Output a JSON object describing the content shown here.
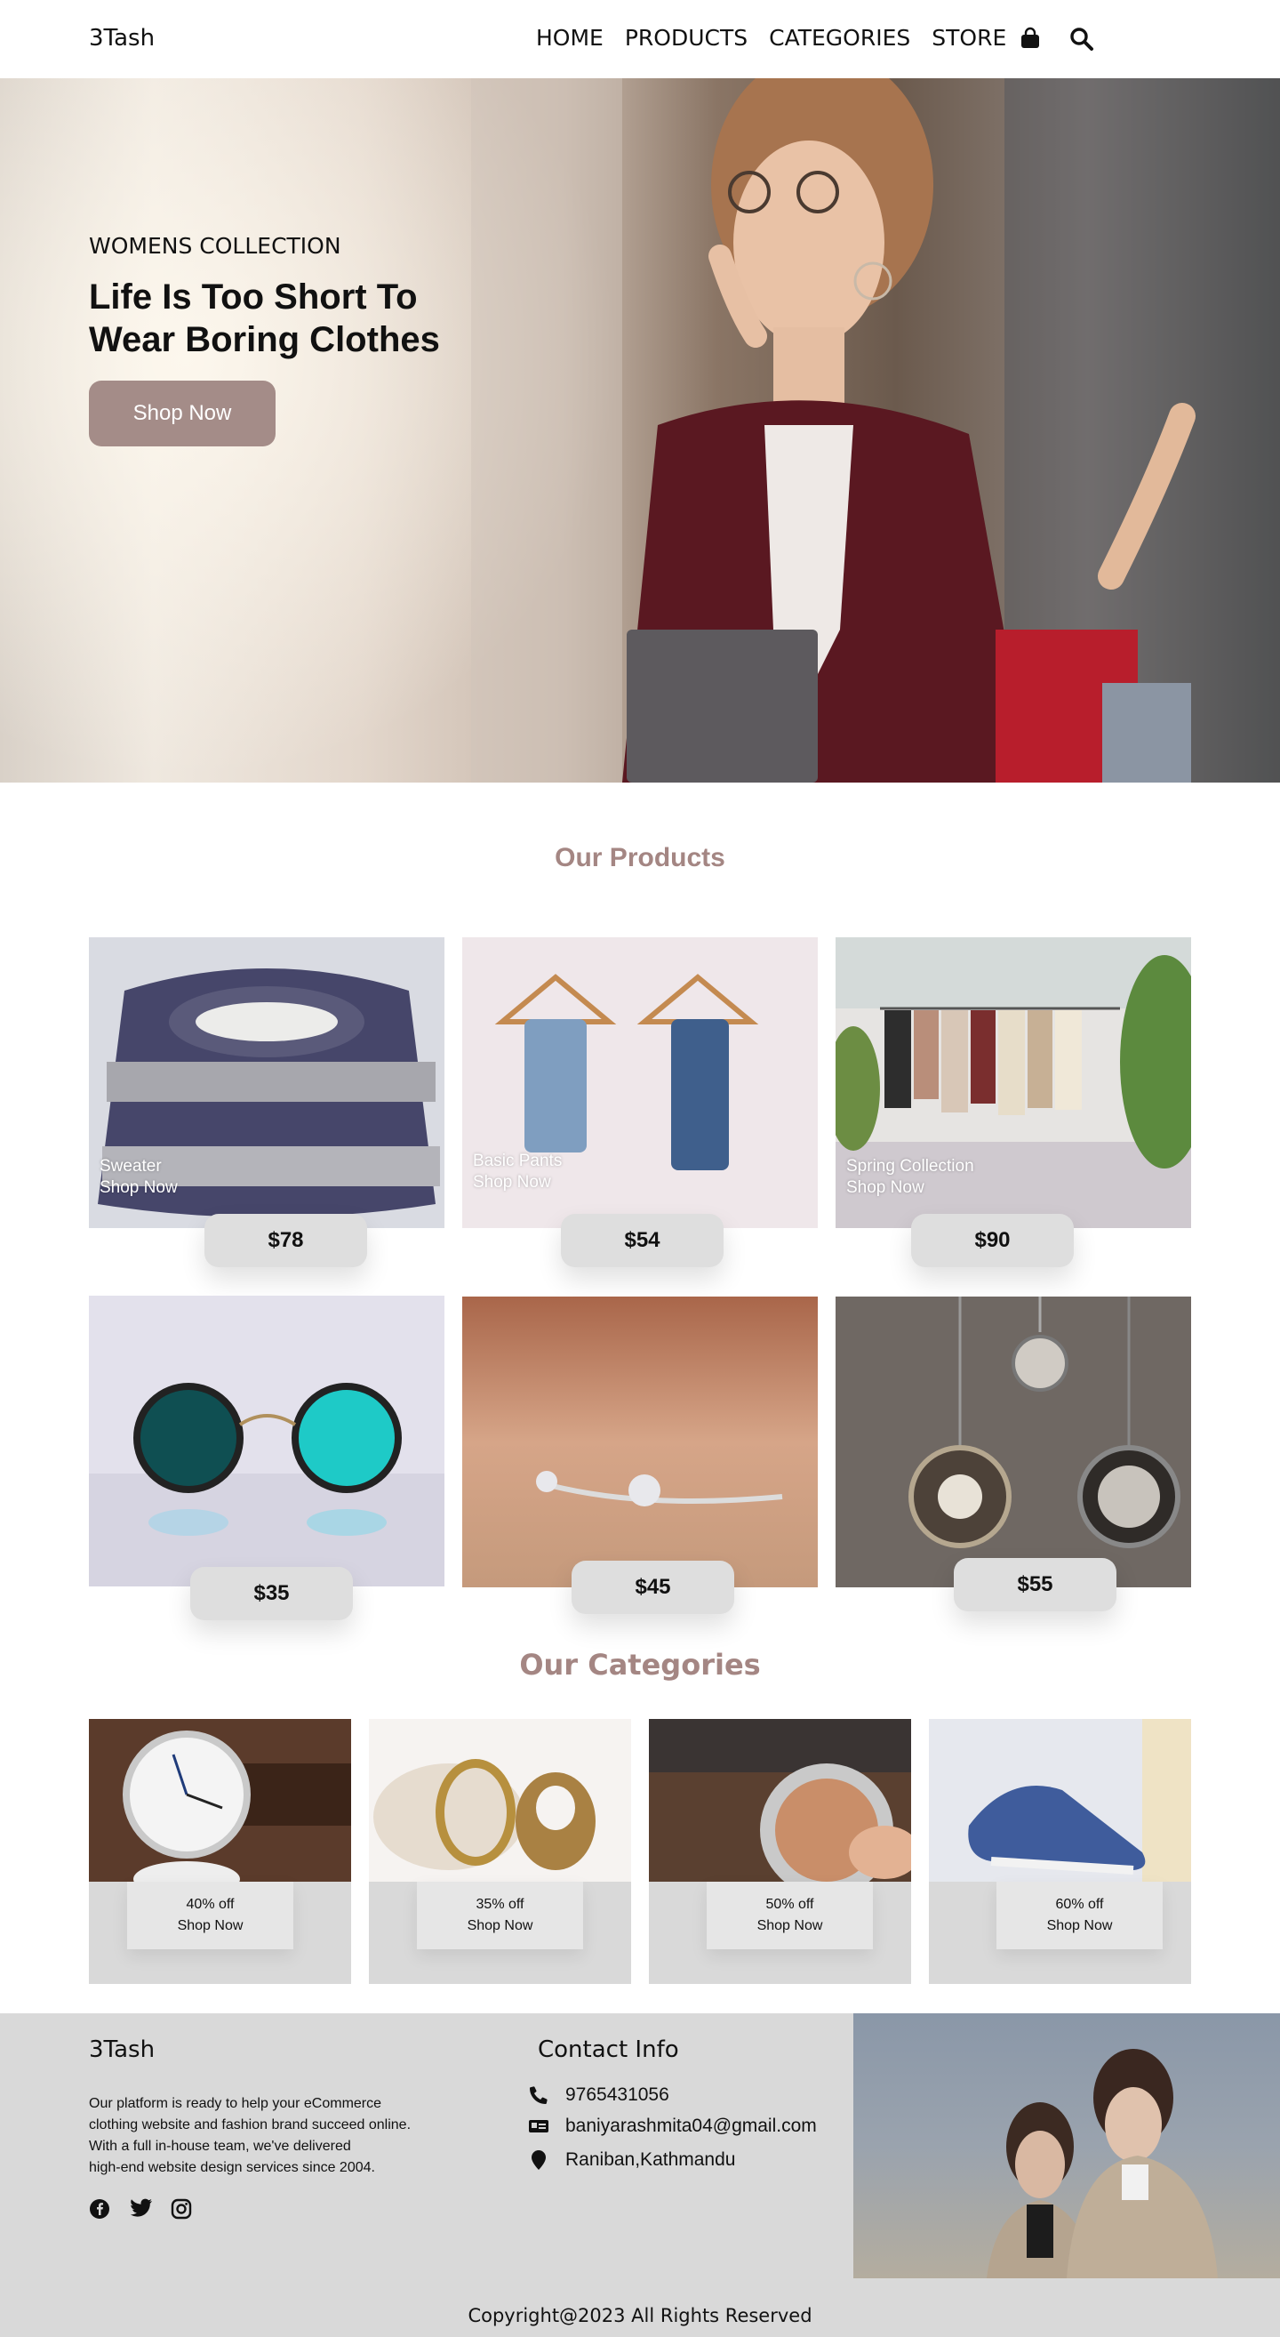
{
  "nav": {
    "logo": "3Tash",
    "links": [
      "HOME",
      "PRODUCTS",
      "CATEGORIES",
      "STORE"
    ],
    "icons": [
      "shopping-bag-icon",
      "search-icon"
    ]
  },
  "hero": {
    "subtitle": "WOMENS COLLECTION",
    "title": "Life Is Too Short To Wear Boring Clothes",
    "button": "Shop Now"
  },
  "products": {
    "title": "Our Products",
    "items": [
      {
        "name": "Sweater",
        "link": "Shop Now",
        "price": "$78"
      },
      {
        "name": "Basic Pants",
        "link": "Shop Now",
        "price": "$54"
      },
      {
        "name": "Spring Collection",
        "link": "Shop Now",
        "price": "$90"
      },
      {
        "name": "",
        "link": "",
        "price": "$35"
      },
      {
        "name": "",
        "link": "",
        "price": "$45"
      },
      {
        "name": "",
        "link": "",
        "price": "$55"
      }
    ]
  },
  "categories": {
    "title": "Our Categories",
    "items": [
      {
        "discount": "40% off",
        "link": "Shop Now"
      },
      {
        "discount": "35% off",
        "link": "Shop Now"
      },
      {
        "discount": "50% off",
        "link": "Shop Now"
      },
      {
        "discount": "60% off",
        "link": "Shop Now"
      }
    ]
  },
  "footer": {
    "logo": "3Tash",
    "about": "Our platform is ready to help your eCommerce\n clothing website and fashion brand succeed online.\nWith a full in-house team, we've delivered\nhigh-end website design services since 2004.",
    "contact_title": "Contact Info",
    "phone": "9765431056",
    "email": "baniyarashmita04@gmail.com",
    "address": "Raniban,Kathmandu",
    "copyright": "Copyright@2023 All Rights Reserved",
    "social_icons": [
      "facebook-icon",
      "twitter-icon",
      "instagram-icon"
    ]
  },
  "colors": {
    "accent": "#a48c88",
    "section_title": "#a48683",
    "price_pill": "#dedede",
    "footer_bg": "#d9d9d9"
  }
}
